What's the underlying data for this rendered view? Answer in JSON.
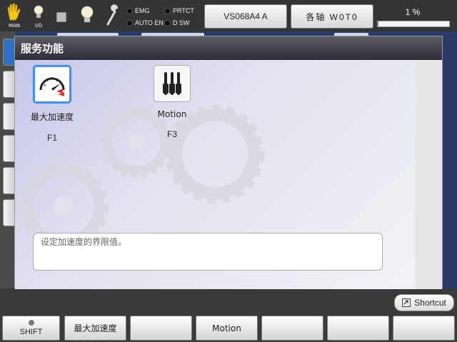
{
  "top_bar": {
    "mode_label": "MAN",
    "io_label": "I/O",
    "status": {
      "emg": "EMG",
      "prtct": "PRTCT",
      "auto_en": "AUTO EN",
      "d_sw": "D SW"
    },
    "robot_button": "VS068A4 A",
    "axis_button": "各轴 W0T0",
    "speed_text": "1 %",
    "speed_value": 1
  },
  "dialog": {
    "title": "服务功能",
    "functions": [
      {
        "label": "最大加速度",
        "key": "F1",
        "icon": "speedometer-icon",
        "selected": true
      },
      {
        "label": "Motion",
        "key": "F3",
        "icon": "motion-sliders-icon",
        "selected": false
      }
    ],
    "description": "设定加速度的界限值。"
  },
  "shortcut_label": "Shortcut",
  "function_keys": [
    {
      "label": "SHIFT"
    },
    {
      "label": "最大加速度"
    },
    {
      "label": ""
    },
    {
      "label": "Motion"
    },
    {
      "label": ""
    },
    {
      "label": ""
    },
    {
      "label": ""
    }
  ],
  "colors": {
    "accent": "#4a8fe4",
    "title_bar": "#2e2e3a",
    "progress_fill": "#3c7fd0"
  }
}
